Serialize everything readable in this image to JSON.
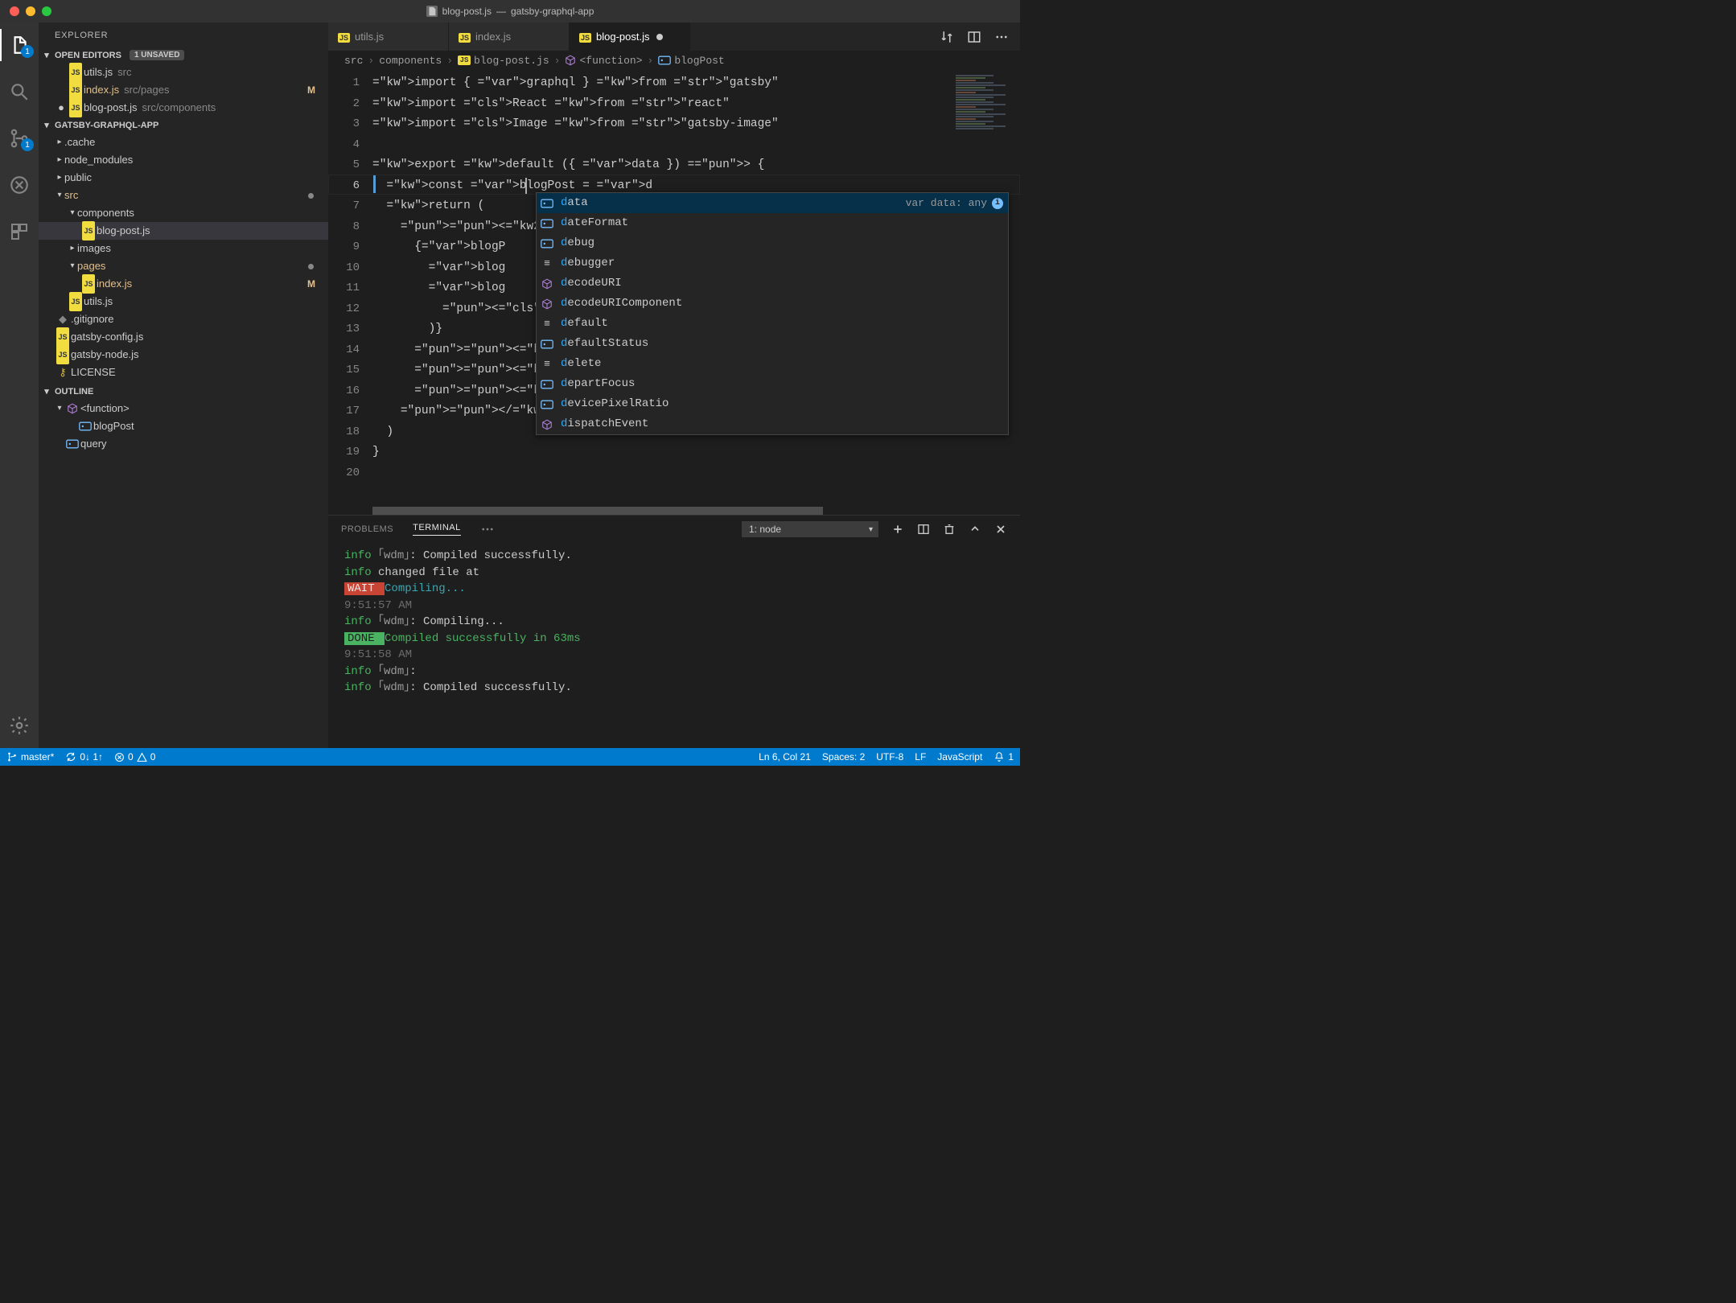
{
  "title": {
    "file_icon": "js",
    "file": "blog-post.js",
    "project": "gatsby-graphql-app"
  },
  "activity_badges": {
    "explorer": "1",
    "scm": "1"
  },
  "sidebar": {
    "title": "EXPLORER",
    "open_editors": {
      "label": "OPEN EDITORS",
      "unsaved": "1 UNSAVED"
    },
    "open_tabs": [
      {
        "icon": "JS",
        "name": "utils.js",
        "path": "src",
        "marker": ""
      },
      {
        "icon": "JS",
        "name": "index.js",
        "path": "src/pages",
        "marker": "M",
        "warn": true
      },
      {
        "icon": "JS",
        "name": "blog-post.js",
        "path": "src/components",
        "marker": "●",
        "dirty": true
      }
    ],
    "project_header": "GATSBY-GRAPHQL-APP",
    "tree": [
      {
        "d": 1,
        "chev": "▸",
        "name": ".cache",
        "kind": "folder"
      },
      {
        "d": 1,
        "chev": "▸",
        "name": "node_modules",
        "kind": "folder"
      },
      {
        "d": 1,
        "chev": "▸",
        "name": "public",
        "kind": "folder"
      },
      {
        "d": 1,
        "chev": "▾",
        "name": "src",
        "kind": "folder",
        "warn": true,
        "dot": true
      },
      {
        "d": 2,
        "chev": "▾",
        "name": "components",
        "kind": "folder"
      },
      {
        "d": 3,
        "icon": "JS",
        "name": "blog-post.js",
        "kind": "file",
        "selected": true
      },
      {
        "d": 2,
        "chev": "▸",
        "name": "images",
        "kind": "folder"
      },
      {
        "d": 2,
        "chev": "▾",
        "name": "pages",
        "kind": "folder",
        "warn": true,
        "dot": true
      },
      {
        "d": 3,
        "icon": "JS",
        "name": "index.js",
        "kind": "file",
        "warn": true,
        "marker": "M"
      },
      {
        "d": 2,
        "icon": "JS",
        "name": "utils.js",
        "kind": "file"
      },
      {
        "d": 1,
        "icon": "git",
        "name": ".gitignore",
        "kind": "file"
      },
      {
        "d": 1,
        "icon": "JS",
        "name": "gatsby-config.js",
        "kind": "file"
      },
      {
        "d": 1,
        "icon": "JS",
        "name": "gatsby-node.js",
        "kind": "file"
      },
      {
        "d": 1,
        "icon": "lic",
        "name": "LICENSE",
        "kind": "file"
      }
    ],
    "outline": {
      "label": "OUTLINE",
      "items": [
        {
          "d": 1,
          "chev": "▾",
          "icon": "cube",
          "name": "<function>"
        },
        {
          "d": 2,
          "icon": "var",
          "name": "blogPost"
        },
        {
          "d": 1,
          "icon": "var",
          "name": "query"
        }
      ]
    }
  },
  "tabs": [
    {
      "icon": "JS",
      "name": "utils.js",
      "active": false
    },
    {
      "icon": "JS",
      "name": "index.js",
      "active": false
    },
    {
      "icon": "JS",
      "name": "blog-post.js",
      "active": true,
      "dirty": true
    }
  ],
  "breadcrumbs": [
    {
      "t": "src"
    },
    {
      "t": "components"
    },
    {
      "icon": "JS",
      "t": "blog-post.js"
    },
    {
      "icon": "cube",
      "t": "<function>"
    },
    {
      "icon": "var",
      "t": "blogPost"
    }
  ],
  "code_lines": [
    "import { graphql } from \"gatsby\"",
    "import React from \"react\"",
    "import Image from \"gatsby-image\"",
    "",
    "export default ({ data }) => {",
    "  const blogPost = d",
    "  return (",
    "    <div>",
    "      {blogP",
    "        blog",
    "        blog",
    "          <I",
    "        )}",
    "      <h1>{b",
    "      <div>P",
    "      <div d",
    "    </div>",
    "  )",
    "}",
    ""
  ],
  "cursor": {
    "line": 6,
    "col": 21
  },
  "suggest": {
    "detail": "var data: any",
    "items": [
      {
        "k": "var",
        "label": "data",
        "match": "d",
        "sel": true
      },
      {
        "k": "var",
        "label": "dateFormat",
        "match": "d"
      },
      {
        "k": "var",
        "label": "debug",
        "match": "d"
      },
      {
        "k": "kw",
        "label": "debugger",
        "match": "d"
      },
      {
        "k": "method",
        "label": "decodeURI",
        "match": "d"
      },
      {
        "k": "method",
        "label": "decodeURIComponent",
        "match": "d"
      },
      {
        "k": "kw",
        "label": "default",
        "match": "d"
      },
      {
        "k": "var",
        "label": "defaultStatus",
        "match": "d"
      },
      {
        "k": "kw",
        "label": "delete",
        "match": "d"
      },
      {
        "k": "var",
        "label": "departFocus",
        "match": "d"
      },
      {
        "k": "var",
        "label": "devicePixelRatio",
        "match": "d"
      },
      {
        "k": "method",
        "label": "dispatchEvent",
        "match": "d"
      }
    ]
  },
  "panel": {
    "tabs": {
      "problems": "PROBLEMS",
      "terminal": "TERMINAL"
    },
    "select": "1: node",
    "lines": [
      {
        "parts": [
          {
            "c": "t-info",
            "t": "info"
          },
          {
            "c": "t-dim",
            "t": " ｢wdm｣"
          },
          {
            "c": "",
            "t": ": Compiled successfully."
          }
        ]
      },
      {
        "parts": [
          {
            "c": "t-info",
            "t": "info"
          },
          {
            "c": "",
            "t": " changed file at"
          }
        ]
      },
      {
        "parts": [
          {
            "c": "t-wait",
            "t": " WAIT "
          },
          {
            "c": "t-cyan",
            "t": " Compiling..."
          }
        ]
      },
      {
        "parts": [
          {
            "c": "t-time",
            "t": "9:51:57 AM"
          }
        ]
      },
      {
        "parts": [
          {
            "c": "",
            "t": " "
          }
        ]
      },
      {
        "parts": [
          {
            "c": "t-info",
            "t": "info"
          },
          {
            "c": "t-dim",
            "t": " ｢wdm｣"
          },
          {
            "c": "",
            "t": ": Compiling..."
          }
        ]
      },
      {
        "parts": [
          {
            "c": "t-done",
            "t": " DONE "
          },
          {
            "c": "t-info",
            "t": " Compiled successfully in 63ms"
          }
        ]
      },
      {
        "parts": [
          {
            "c": "t-time",
            "t": "9:51:58 AM"
          }
        ]
      },
      {
        "parts": [
          {
            "c": "",
            "t": " "
          }
        ]
      },
      {
        "parts": [
          {
            "c": "t-info",
            "t": "info"
          },
          {
            "c": "t-dim",
            "t": " ｢wdm｣"
          },
          {
            "c": "",
            "t": ":"
          }
        ]
      },
      {
        "parts": [
          {
            "c": "t-info",
            "t": "info"
          },
          {
            "c": "t-dim",
            "t": " ｢wdm｣"
          },
          {
            "c": "",
            "t": ": Compiled successfully."
          }
        ]
      }
    ]
  },
  "status": {
    "branch": "master*",
    "sync": "0↓ 1↑",
    "errors": "0",
    "warnings": "0",
    "pos": "Ln 6, Col 21",
    "spaces": "Spaces: 2",
    "encoding": "UTF-8",
    "eol": "LF",
    "lang": "JavaScript",
    "feedback": "1"
  }
}
